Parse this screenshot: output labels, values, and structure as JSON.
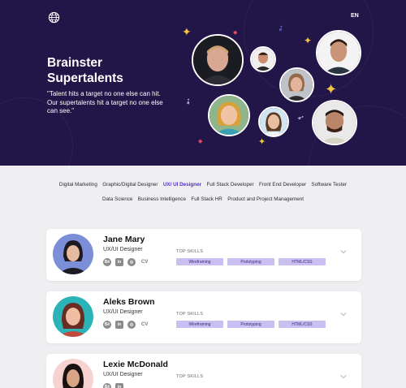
{
  "header": {
    "globe_icon": "globe-icon",
    "lang": "EN"
  },
  "hero": {
    "title": "Brainster Supertalents",
    "quote": "\"Talent hits a target no one else can hit. Our supertalents hit a target no one else can see.\""
  },
  "filters": {
    "row1": [
      "Digital Marketing",
      "Graphic/Digital Designer",
      "UX/ UI Designer",
      "Full Stack Developer",
      "Front End Developer",
      "Software Tester"
    ],
    "row2": [
      "Data Science",
      "Business Intelligence",
      "Full Stack HR",
      "Product and Project Management"
    ],
    "active": "UX/ UI Designer"
  },
  "cards": [
    {
      "name": "Jane Mary",
      "role": "UX/UI Designer",
      "cv": "CV",
      "skills_title": "TOP SKILLS",
      "skills": [
        "Wireframing",
        "Prototyping",
        "HTML/CSS"
      ]
    },
    {
      "name": "Aleks Brown",
      "role": "UX/UI Designer",
      "cv": "CV",
      "skills_title": "TOP SKILLS",
      "skills": [
        "Wireframing",
        "Prototyping",
        "HTML/CSS"
      ]
    },
    {
      "name": "Lexie McDonald",
      "role": "UX/UI Designer",
      "cv": "CV",
      "skills_title": "TOP SKILLS",
      "skills": [
        "",
        "",
        ""
      ]
    }
  ],
  "colors": {
    "hero_bg": "#221547",
    "accent": "#5230c7",
    "skill_bg": "#c9bff1"
  }
}
